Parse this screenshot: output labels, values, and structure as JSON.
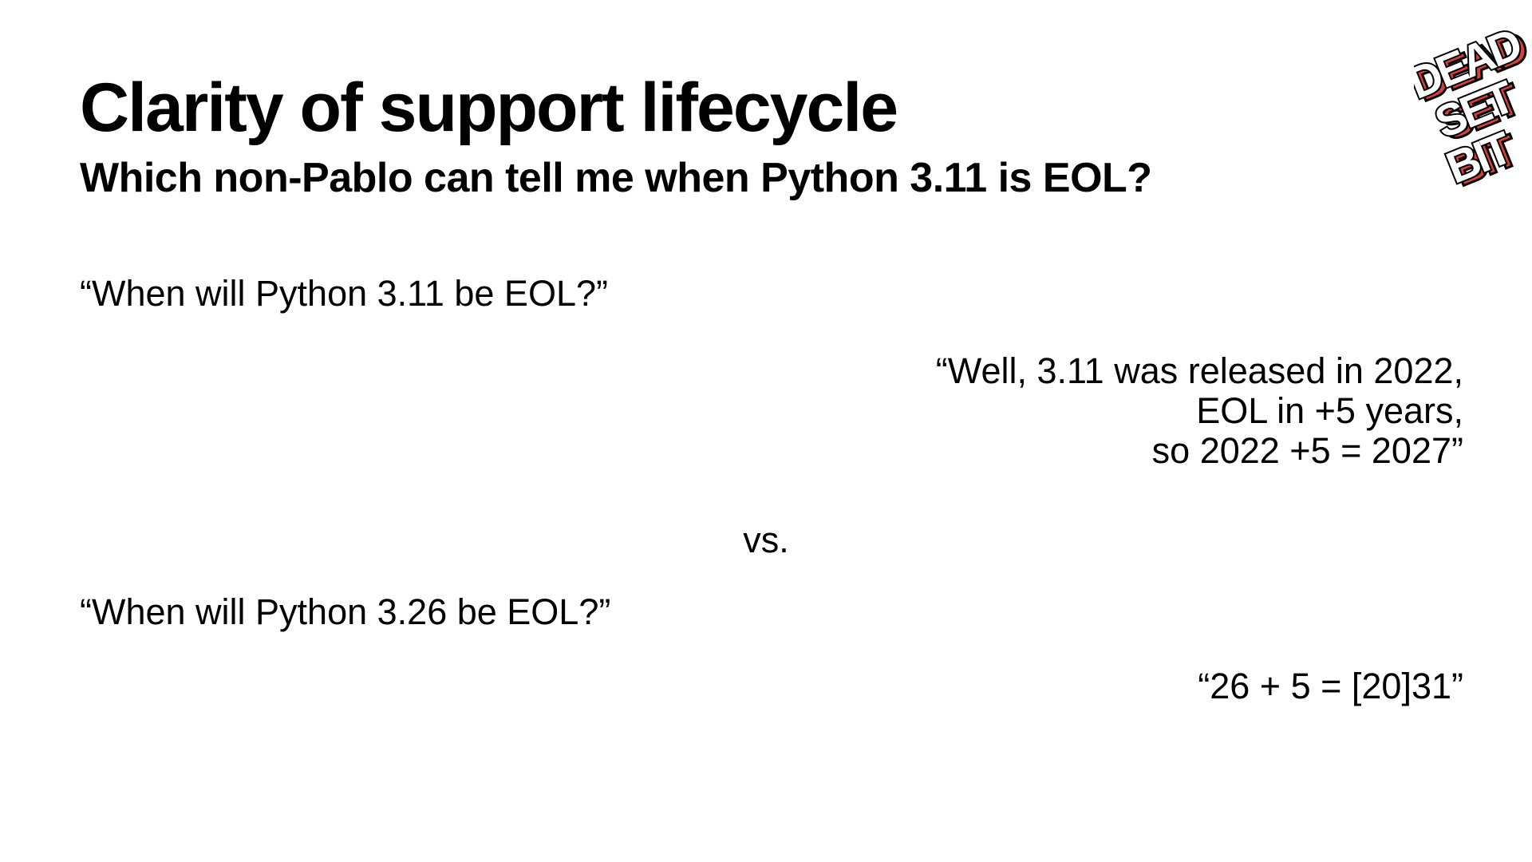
{
  "slide": {
    "title": "Clarity of support lifecycle",
    "subtitle": "Which non-Pablo can tell me when Python 3.11 is EOL?",
    "question_1": "“When will Python 3.11 be EOL?”",
    "answer_1_lines": [
      "“Well, 3.11 was released in 2022,",
      "EOL in +5 years,",
      "so 2022 +5 = 2027”"
    ],
    "separator": "vs.",
    "question_2": "“When will Python 3.26 be EOL?”",
    "answer_2": "“26 + 5 = [20]31”"
  },
  "logo": {
    "lines": [
      "DEAD",
      "SET",
      "BIT"
    ],
    "face_color": "#ffffff",
    "outline_color": "#000000",
    "shadow_color": "#d9403c"
  }
}
